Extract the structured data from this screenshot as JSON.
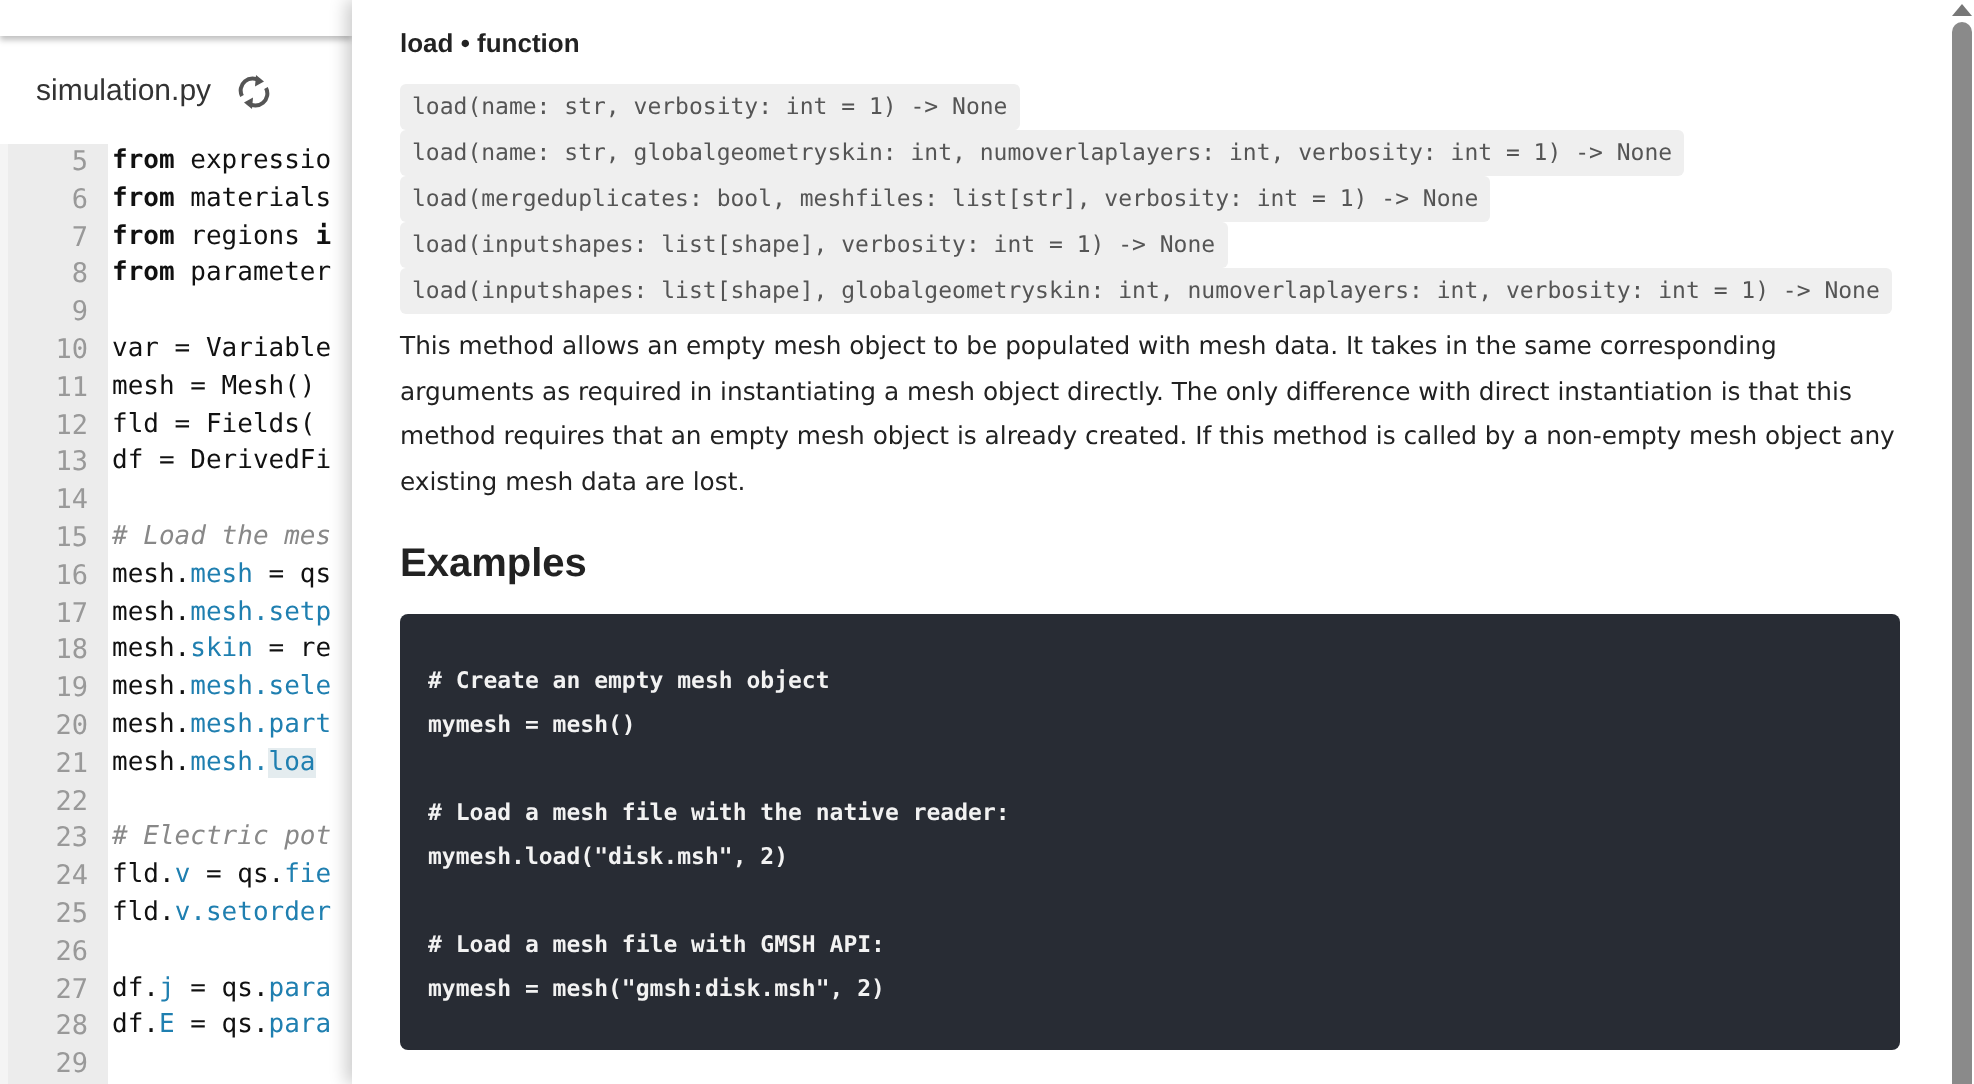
{
  "editor": {
    "file_name": "simulation.py",
    "lines": [
      {
        "number": "5",
        "segments": [
          {
            "kind": "keyword",
            "text": "from"
          },
          {
            "kind": "plain",
            "text": " expressio"
          }
        ]
      },
      {
        "number": "6",
        "segments": [
          {
            "kind": "keyword",
            "text": "from"
          },
          {
            "kind": "plain",
            "text": " materials"
          }
        ]
      },
      {
        "number": "7",
        "segments": [
          {
            "kind": "keyword",
            "text": "from"
          },
          {
            "kind": "plain",
            "text": " regions "
          },
          {
            "kind": "keyword",
            "text": "i"
          }
        ]
      },
      {
        "number": "8",
        "segments": [
          {
            "kind": "keyword",
            "text": "from"
          },
          {
            "kind": "plain",
            "text": " parameter"
          }
        ]
      },
      {
        "number": "9"
      },
      {
        "number": "10",
        "segments": [
          {
            "kind": "plain",
            "text": "var = Variable"
          }
        ]
      },
      {
        "number": "11",
        "segments": [
          {
            "kind": "plain",
            "text": "mesh = Mesh()"
          }
        ]
      },
      {
        "number": "12",
        "segments": [
          {
            "kind": "plain",
            "text": "fld = Fields("
          }
        ]
      },
      {
        "number": "13",
        "segments": [
          {
            "kind": "plain",
            "text": "df = DerivedFi"
          }
        ]
      },
      {
        "number": "14"
      },
      {
        "number": "15",
        "segments": [
          {
            "kind": "comment",
            "text": "# Load the mes"
          }
        ]
      },
      {
        "number": "16",
        "segments": [
          {
            "kind": "plain",
            "text": "mesh."
          },
          {
            "kind": "member",
            "text": "mesh"
          },
          {
            "kind": "plain",
            "text": " = qs"
          }
        ]
      },
      {
        "number": "17",
        "segments": [
          {
            "kind": "plain",
            "text": "mesh."
          },
          {
            "kind": "member",
            "text": "mesh.setp"
          }
        ]
      },
      {
        "number": "18",
        "segments": [
          {
            "kind": "plain",
            "text": "mesh."
          },
          {
            "kind": "member",
            "text": "skin"
          },
          {
            "kind": "plain",
            "text": " = re"
          }
        ]
      },
      {
        "number": "19",
        "segments": [
          {
            "kind": "plain",
            "text": "mesh."
          },
          {
            "kind": "member",
            "text": "mesh.sele"
          }
        ]
      },
      {
        "number": "20",
        "segments": [
          {
            "kind": "plain",
            "text": "mesh."
          },
          {
            "kind": "member",
            "text": "mesh.part"
          }
        ]
      },
      {
        "number": "21",
        "segments": [
          {
            "kind": "plain",
            "text": "mesh."
          },
          {
            "kind": "member",
            "text": "mesh."
          },
          {
            "kind": "hover",
            "text": "loa"
          }
        ]
      },
      {
        "number": "22"
      },
      {
        "number": "23",
        "segments": [
          {
            "kind": "comment",
            "text": "# Electric pot"
          }
        ]
      },
      {
        "number": "24",
        "segments": [
          {
            "kind": "plain",
            "text": "fld."
          },
          {
            "kind": "member",
            "text": "v"
          },
          {
            "kind": "plain",
            "text": " = qs."
          },
          {
            "kind": "member",
            "text": "fie"
          }
        ]
      },
      {
        "number": "25",
        "segments": [
          {
            "kind": "plain",
            "text": "fld."
          },
          {
            "kind": "member",
            "text": "v.setorder"
          }
        ]
      },
      {
        "number": "26"
      },
      {
        "number": "27",
        "segments": [
          {
            "kind": "plain",
            "text": "df."
          },
          {
            "kind": "member",
            "text": "j"
          },
          {
            "kind": "plain",
            "text": " = qs."
          },
          {
            "kind": "member",
            "text": "para"
          }
        ]
      },
      {
        "number": "28",
        "segments": [
          {
            "kind": "plain",
            "text": "df."
          },
          {
            "kind": "member",
            "text": "E"
          },
          {
            "kind": "plain",
            "text": " = qs."
          },
          {
            "kind": "member",
            "text": "para"
          }
        ]
      },
      {
        "number": "29"
      }
    ]
  },
  "popup": {
    "title": "load • function",
    "signatures": [
      "load(name: str, verbosity: int = 1) -> None",
      "load(name: str, globalgeometryskin: int, numoverlaplayers: int, verbosity: int = 1) -> None",
      "load(mergeduplicates: bool, meshfiles: list[str], verbosity: int = 1) -> None",
      "load(inputshapes: list[shape], verbosity: int = 1) -> None",
      "load(inputshapes: list[shape], globalgeometryskin: int, numoverlaplayers: int, verbosity: int = 1) -> None"
    ],
    "description": "This method allows an empty mesh object to be populated with mesh data. It takes in the same corresponding arguments as required in instantiating a mesh object directly. The only difference with direct instantiation is that this method requires that an empty mesh object is already created. If this method is called by a non-empty mesh object any existing mesh data are lost.",
    "examples_heading": "Examples",
    "examples": [
      {
        "comment": "# Create an empty mesh object",
        "code": "mymesh = mesh()"
      },
      {
        "comment": "# Load a mesh file with the native reader:",
        "code": "mymesh.load(\"disk.msh\", 2)"
      },
      {
        "comment": "# Load a mesh file with GMSH API:",
        "code": "mymesh = mesh(\"gmsh:disk.msh\", 2)"
      }
    ]
  }
}
